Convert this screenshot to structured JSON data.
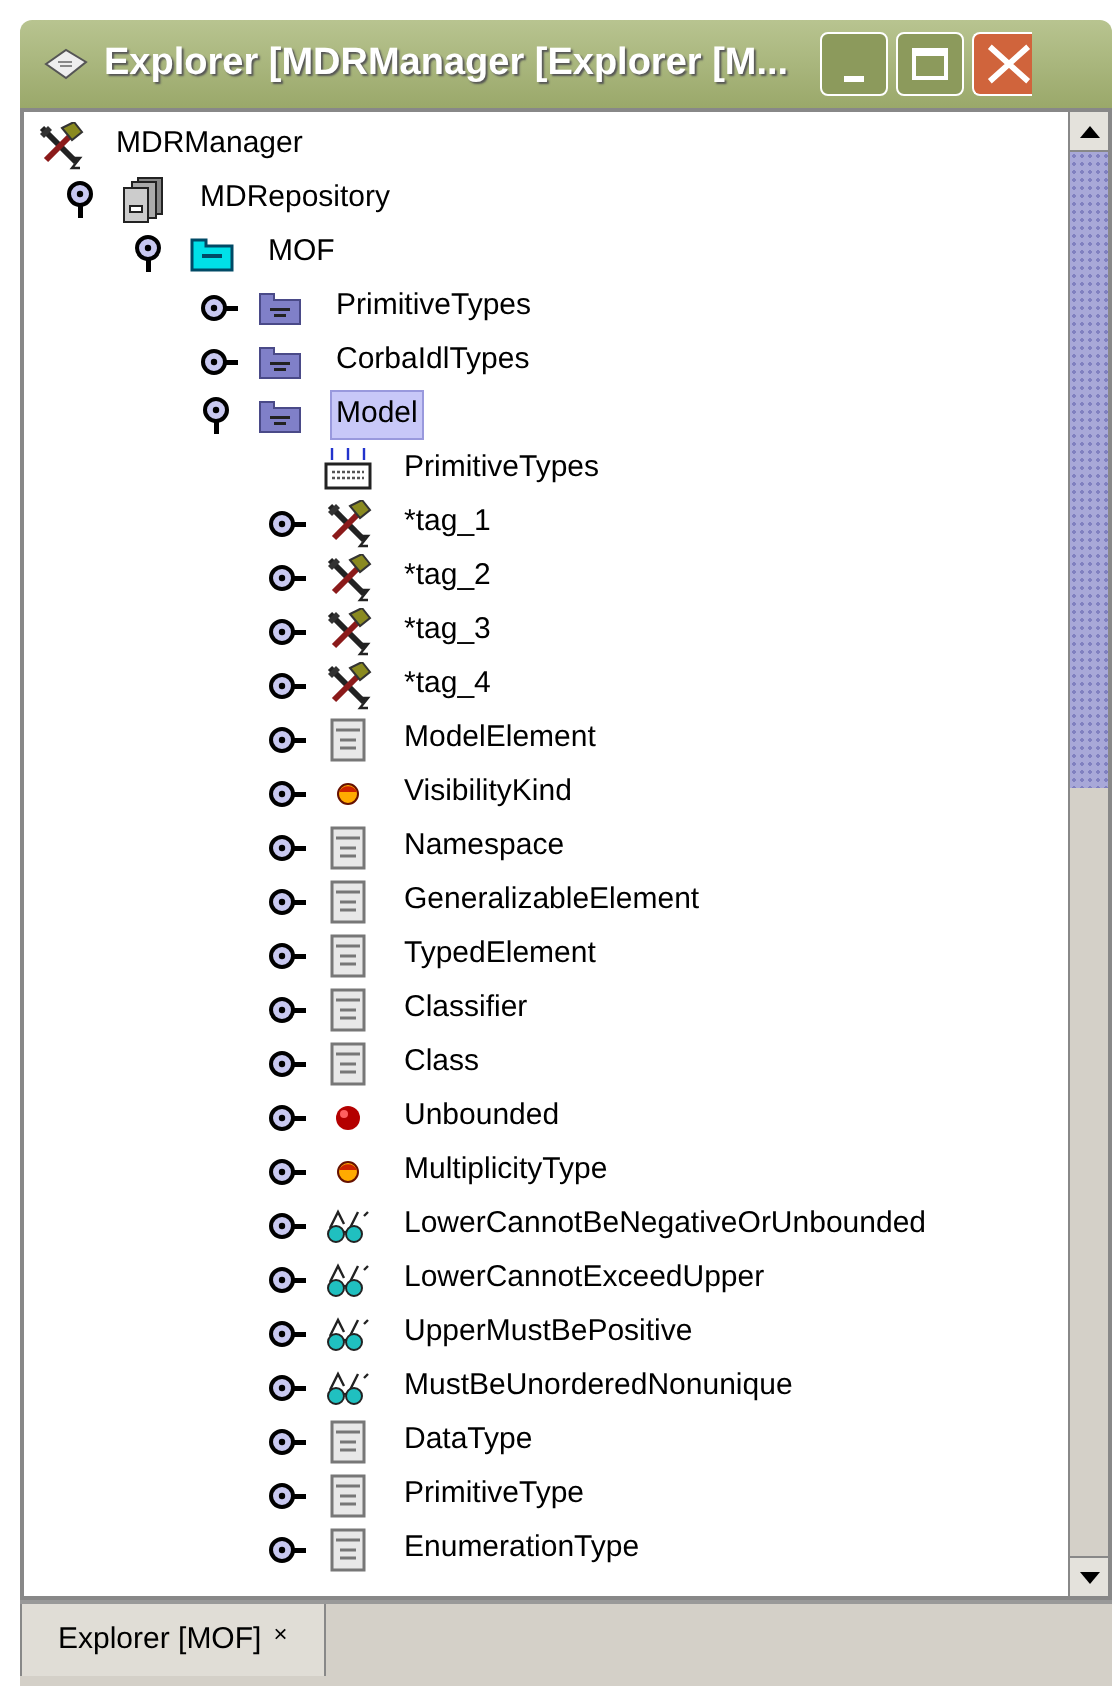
{
  "window": {
    "title": "Explorer [MDRManager [Explorer [M..."
  },
  "tree": [
    {
      "label": "MDRManager",
      "kind": "tools",
      "selected": false,
      "children": [
        {
          "label": "MDRepository",
          "kind": "repository",
          "expanded": true,
          "selected": false,
          "children": [
            {
              "label": "MOF",
              "kind": "open-package",
              "expanded": true,
              "selected": false,
              "children": [
                {
                  "label": "PrimitiveTypes",
                  "kind": "package",
                  "expanded": false,
                  "selected": false
                },
                {
                  "label": "CorbaIdlTypes",
                  "kind": "package",
                  "expanded": false,
                  "selected": false
                },
                {
                  "label": "Model",
                  "kind": "package",
                  "expanded": true,
                  "selected": true,
                  "children": [
                    {
                      "label": "PrimitiveTypes",
                      "kind": "import",
                      "selected": false
                    },
                    {
                      "label": "*tag_1",
                      "kind": "tools",
                      "expanded": false,
                      "selected": false
                    },
                    {
                      "label": "*tag_2",
                      "kind": "tools",
                      "expanded": false,
                      "selected": false
                    },
                    {
                      "label": "*tag_3",
                      "kind": "tools",
                      "expanded": false,
                      "selected": false
                    },
                    {
                      "label": "*tag_4",
                      "kind": "tools",
                      "expanded": false,
                      "selected": false
                    },
                    {
                      "label": "ModelElement",
                      "kind": "class",
                      "expanded": false,
                      "selected": false
                    },
                    {
                      "label": "VisibilityKind",
                      "kind": "enum",
                      "expanded": false,
                      "selected": false
                    },
                    {
                      "label": "Namespace",
                      "kind": "class",
                      "expanded": false,
                      "selected": false
                    },
                    {
                      "label": "GeneralizableElement",
                      "kind": "class",
                      "expanded": false,
                      "selected": false
                    },
                    {
                      "label": "TypedElement",
                      "kind": "class",
                      "expanded": false,
                      "selected": false
                    },
                    {
                      "label": "Classifier",
                      "kind": "class",
                      "expanded": false,
                      "selected": false
                    },
                    {
                      "label": "Class",
                      "kind": "class",
                      "expanded": false,
                      "selected": false
                    },
                    {
                      "label": "Unbounded",
                      "kind": "constant",
                      "expanded": false,
                      "selected": false
                    },
                    {
                      "label": "MultiplicityType",
                      "kind": "enum",
                      "expanded": false,
                      "selected": false
                    },
                    {
                      "label": "LowerCannotBeNegativeOrUnbounded",
                      "kind": "constraint",
                      "expanded": false,
                      "selected": false
                    },
                    {
                      "label": "LowerCannotExceedUpper",
                      "kind": "constraint",
                      "expanded": false,
                      "selected": false
                    },
                    {
                      "label": "UpperMustBePositive",
                      "kind": "constraint",
                      "expanded": false,
                      "selected": false
                    },
                    {
                      "label": "MustBeUnorderedNonunique",
                      "kind": "constraint",
                      "expanded": false,
                      "selected": false
                    },
                    {
                      "label": "DataType",
                      "kind": "class",
                      "expanded": false,
                      "selected": false
                    },
                    {
                      "label": "PrimitiveType",
                      "kind": "class",
                      "expanded": false,
                      "selected": false
                    },
                    {
                      "label": "EnumerationType",
                      "kind": "class",
                      "expanded": false,
                      "selected": false
                    }
                  ]
                }
              ]
            }
          ]
        }
      ]
    }
  ],
  "tabs": [
    {
      "label": "Explorer [MOF]",
      "close": "×",
      "selected": true
    }
  ]
}
